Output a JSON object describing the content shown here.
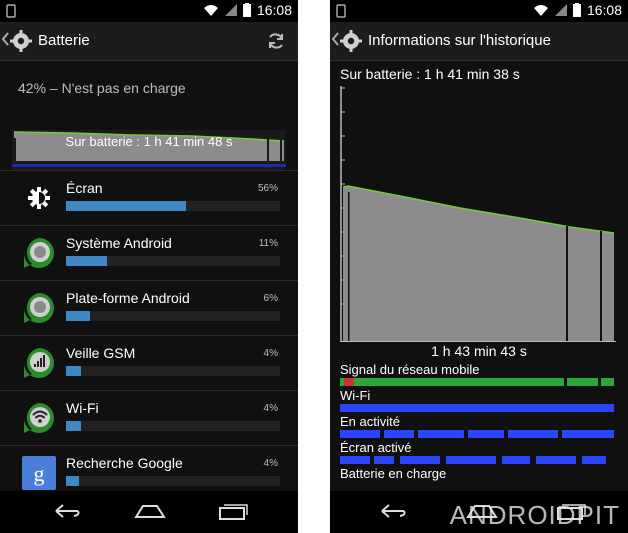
{
  "left": {
    "statusbar": {
      "time": "16:08"
    },
    "actionbar": {
      "title": "Batterie"
    },
    "summary": "42% – N'est pas en charge",
    "graph_label": "Sur batterie : 1 h 41 min 48 s",
    "items": [
      {
        "name": "Écran",
        "percent": "56%",
        "fraction": 0.56,
        "icon": "display-icon"
      },
      {
        "name": "Système Android",
        "percent": "11%",
        "fraction": 0.19,
        "icon": "android-system-icon"
      },
      {
        "name": "Plate-forme Android",
        "percent": "6%",
        "fraction": 0.11,
        "icon": "android-platform-icon"
      },
      {
        "name": "Veille GSM",
        "percent": "4%",
        "fraction": 0.07,
        "icon": "cell-standby-icon"
      },
      {
        "name": "Wi-Fi",
        "percent": "4%",
        "fraction": 0.07,
        "icon": "wifi-icon"
      },
      {
        "name": "Recherche Google",
        "percent": "4%",
        "fraction": 0.06,
        "icon": "google-search-icon"
      }
    ]
  },
  "right": {
    "statusbar": {
      "time": "16:08"
    },
    "actionbar": {
      "title": "Informations sur l'historique"
    },
    "on_battery": "Sur batterie : 1 h 41 min 38 s",
    "duration": "1 h 43 min 43 s",
    "signals": [
      {
        "label": "Signal du réseau mobile"
      },
      {
        "label": "Wi-Fi"
      },
      {
        "label": "En activité"
      },
      {
        "label": "Écran activé"
      },
      {
        "label": "Batterie en charge"
      }
    ],
    "watermark": "ANDROIDPIT"
  },
  "colors": {
    "bar_blue": "#3f88c3",
    "graph_gray": "#8c8c8c",
    "line_green": "#6ecf3a",
    "signal_blue": "#2b45ff",
    "signal_green": "#2aa83a",
    "signal_red": "#d03030"
  }
}
